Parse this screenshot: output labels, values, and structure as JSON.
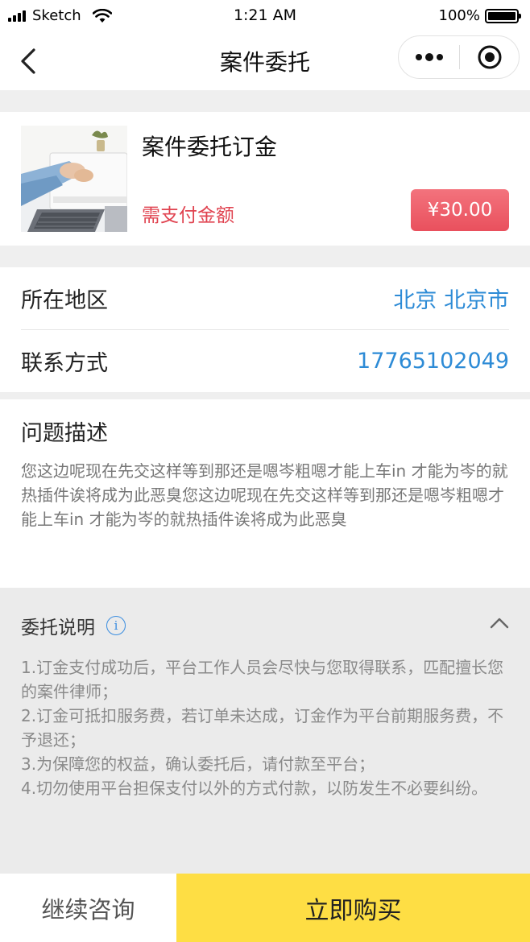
{
  "status_bar": {
    "carrier": "Sketch",
    "time": "1:21 AM",
    "battery": "100%"
  },
  "nav": {
    "title": "案件委托",
    "more_icon": "more-dots-icon",
    "target_icon": "target-icon"
  },
  "order": {
    "thumbnail_icon": "laptop-desk-photo",
    "title": "案件委托订金",
    "amount_label": "需支付金额",
    "price": "¥30.00"
  },
  "info": {
    "region_label": "所在地区",
    "region_value": "北京 北京市",
    "contact_label": "联系方式",
    "contact_value": "17765102049"
  },
  "description": {
    "title": "问题描述",
    "body": "您这边呢现在先交这样等到那还是嗯岑粗嗯才能上车in 才能为岑的就热插件诶将成为此恶臭您这边呢现在先交这样等到那还是嗯岑粗嗯才能上车in 才能为岑的就热插件诶将成为此恶臭"
  },
  "notes": {
    "title": "委托说明",
    "items": [
      "1.订金支付成功后，平台工作人员会尽快与您取得联系，匹配擅长您的案件律师；",
      "2.订金可抵扣服务费，若订单未达成，订金作为平台前期服务费，不予退还；",
      "3.为保障您的权益，确认委托后，请付款至平台；",
      "4.切勿使用平台担保支付以外的方式付款，以防发生不必要纠纷。"
    ]
  },
  "actions": {
    "consult_label": "继续咨询",
    "buy_label": "立即购买"
  },
  "colors": {
    "accent_red": "#e0424f",
    "link_blue": "#2d8bd6",
    "buy_yellow": "#fede44"
  }
}
